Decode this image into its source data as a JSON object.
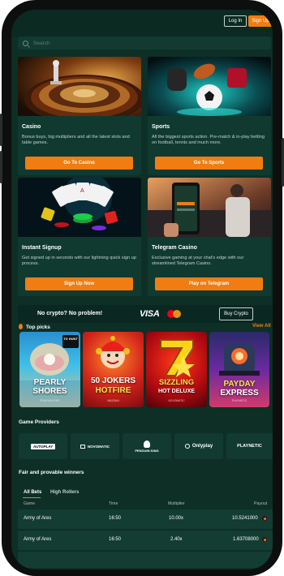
{
  "header": {
    "login_label": "Log In",
    "signup_label": "Sign Up"
  },
  "search": {
    "placeholder": "Search"
  },
  "promos": [
    {
      "title": "Casino",
      "description": "Bonus buys, big multipliers and all the latest slots and table games.",
      "button": "Go To Casino"
    },
    {
      "title": "Sports",
      "description": "All the biggest sports action. Pre-match & in-play betting on football, tennis and much more.",
      "button": "Go To Sports"
    },
    {
      "title": "Instant Signup",
      "description": "Get signed up in seconds with our lightning quick sign up process.",
      "button": "Sign Up Now"
    },
    {
      "title": "Telegram Casino",
      "description": "Exclusive gaming at your chat's edge with our streamlined Telegram Casino.",
      "button": "Play on Telegram"
    }
  ],
  "crypto": {
    "text": "No crypto? No problem!",
    "visa": "VISA",
    "button": "Buy Crypto"
  },
  "top_picks": {
    "title": "Top picks",
    "view_all": "View All",
    "games": [
      {
        "line1": "PEARLY",
        "line2": "SHORES",
        "maker": "PENGUIN KING",
        "badge": "TG HUNT"
      },
      {
        "line1": "50 JOKERS",
        "line2": "HOTFIRE",
        "maker": "WAZDAN"
      },
      {
        "line1": "SIZZLING",
        "line2": "HOT DELUXE",
        "maker": "NOVOMATIC"
      },
      {
        "line1": "PAYDAY",
        "line2": "EXPRESS",
        "maker": "PLAYNETIC"
      }
    ]
  },
  "providers": {
    "title": "Game Providers",
    "items": [
      "AUTOPLAY",
      "NOVOMATIC",
      "PENGUIN KING",
      "Onlyplay",
      "PLAYNETIC"
    ]
  },
  "winners": {
    "title": "Fair and provable winners",
    "tabs": [
      "All Bets",
      "High Rollers"
    ],
    "columns": [
      "Game",
      "Time",
      "Multiplier",
      "Payout"
    ],
    "rows": [
      {
        "game": "Army of Ares",
        "time": "16:50",
        "multiplier": "10.00x",
        "payout": "10.5241000"
      },
      {
        "game": "Army of Ares",
        "time": "16:50",
        "multiplier": "2.40x",
        "payout": "1.63708000"
      }
    ]
  },
  "colors": {
    "accent": "#f07c12",
    "background": "#0d2f26",
    "card": "#103a30"
  }
}
